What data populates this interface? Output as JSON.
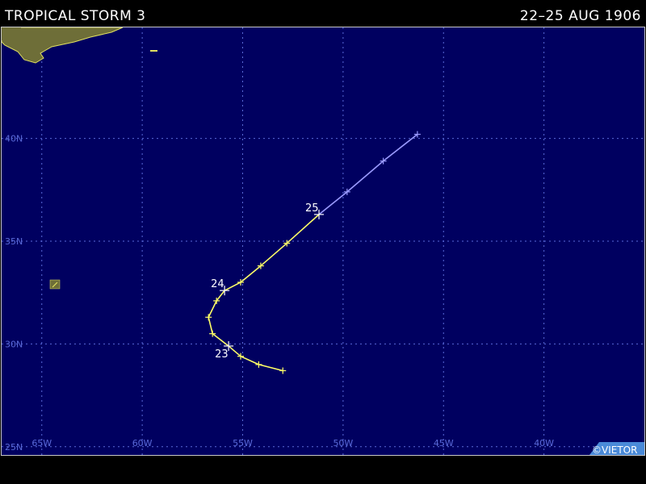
{
  "header": {
    "title": "TROPICAL STORM 3",
    "date_range": "22–25 AUG 1906"
  },
  "map": {
    "lon_range": [
      -67,
      -35
    ],
    "lat_range": [
      24.6,
      45.4
    ],
    "lon_labels": [
      {
        "lon": -65,
        "label": "65W"
      },
      {
        "lon": -60,
        "label": "60W"
      },
      {
        "lon": -55,
        "label": "55W"
      },
      {
        "lon": -50,
        "label": "50W"
      },
      {
        "lon": -45,
        "label": "45W"
      },
      {
        "lon": -40,
        "label": "40W"
      }
    ],
    "lat_labels": [
      {
        "lat": 40,
        "label": "40N"
      },
      {
        "lat": 35,
        "label": "35N"
      },
      {
        "lat": 30,
        "label": "30N"
      },
      {
        "lat": 25,
        "label": "25N"
      }
    ],
    "colors": {
      "ocean": "#000060",
      "grid": "#5a6ad8",
      "land": "#6e6e38",
      "land_outline": "#e0e060",
      "track_storm": "#ffff66",
      "track_extratropical": "#9a9aff",
      "label": "#ffffff",
      "credit_bg": "#4a8ad8"
    },
    "track": [
      {
        "lon": -53.0,
        "lat": 28.7,
        "stage": "storm"
      },
      {
        "lon": -54.2,
        "lat": 29.0,
        "stage": "storm"
      },
      {
        "lon": -55.1,
        "lat": 29.4,
        "stage": "storm"
      },
      {
        "lon": -55.7,
        "lat": 29.9,
        "stage": "storm",
        "day": "23"
      },
      {
        "lon": -56.5,
        "lat": 30.5,
        "stage": "storm"
      },
      {
        "lon": -56.7,
        "lat": 31.3,
        "stage": "storm"
      },
      {
        "lon": -56.3,
        "lat": 32.1,
        "stage": "storm"
      },
      {
        "lon": -55.9,
        "lat": 32.6,
        "stage": "storm",
        "day": "24"
      },
      {
        "lon": -55.1,
        "lat": 33.0,
        "stage": "storm"
      },
      {
        "lon": -54.1,
        "lat": 33.8,
        "stage": "storm"
      },
      {
        "lon": -52.8,
        "lat": 34.9,
        "stage": "storm"
      },
      {
        "lon": -51.2,
        "lat": 36.3,
        "stage": "storm",
        "day": "25"
      },
      {
        "lon": -49.8,
        "lat": 37.4,
        "stage": "extratropical"
      },
      {
        "lon": -48.0,
        "lat": 38.9,
        "stage": "extratropical"
      },
      {
        "lon": -46.3,
        "lat": 40.2,
        "stage": "extratropical"
      }
    ]
  },
  "credit": "©VIETOR"
}
